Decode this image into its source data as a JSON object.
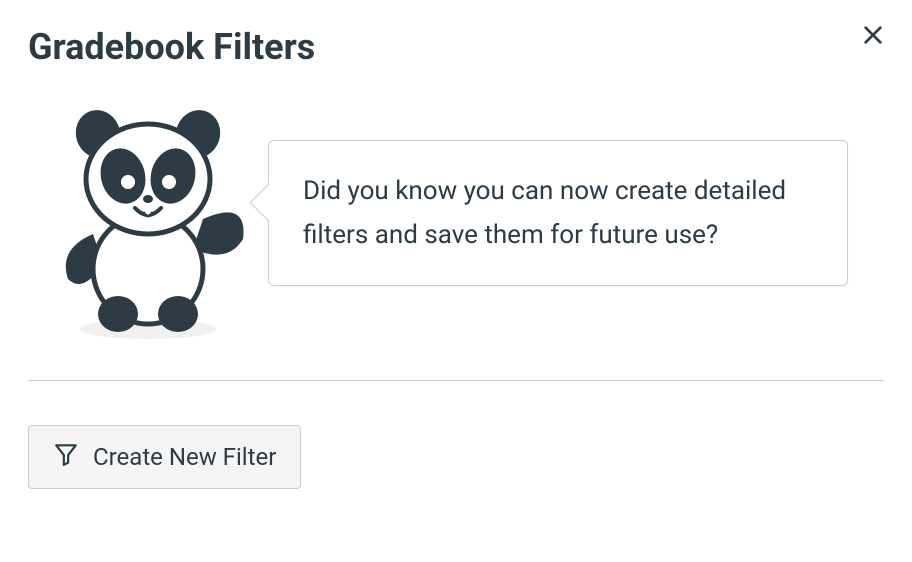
{
  "header": {
    "title": "Gradebook Filters"
  },
  "tip": {
    "message": "Did you know you can now create detailed filters and save them for future use?"
  },
  "actions": {
    "create_label": "Create New Filter"
  },
  "icons": {
    "close": "close-icon",
    "panda": "panda-mascot",
    "filter": "filter-icon"
  }
}
